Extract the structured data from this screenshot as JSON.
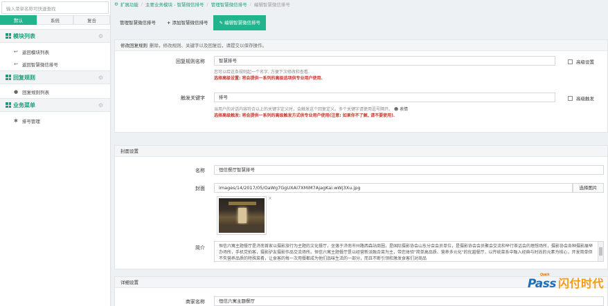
{
  "sidebar": {
    "search_placeholder": "输入菜单名称可快速查找",
    "tabs": [
      "默认",
      "系统",
      "复合"
    ],
    "sections": [
      {
        "title": "模块列表",
        "items": [
          "返回模块列表",
          "返回智慧微信排号"
        ]
      },
      {
        "title": "回复规则",
        "items": [
          "回复规则列表"
        ]
      },
      {
        "title": "业务菜单",
        "items": [
          "排号管理"
        ]
      }
    ]
  },
  "breadcrumb": [
    "扩展功能",
    "主要业务模块 - 智慧微信排号",
    "管理智慧微信排号",
    "编辑智慧微信排号"
  ],
  "tabs": [
    "管理智慧微信排号",
    "添加智慧微信排号",
    "编辑智慧微信排号"
  ],
  "rule_panel": {
    "title": "修改回复规则",
    "note": "删除，修改规则、关键字以及回复后，请提交以保存操作。",
    "rule_name_label": "回复规则名称",
    "rule_name_value": "智慧排号",
    "rule_name_help": "您可以给这条规则起一个名字, 方便下次修改和查看.",
    "rule_name_help_red": "选择高级设置: 将会提供一系列的高级选项供专业用户使用.",
    "advanced_label": "高级设置",
    "keyword_label": "触发关键字",
    "keyword_value": "排号",
    "keyword_help": "当用户的对话内容符合以上的关键字定义时，会触发这个回复定义。多个关键字请使用逗号隔开。",
    "emoji_label": "表情",
    "keyword_help_red": "选择高级触发: 将会提供一系列的高级触发方式供专业用户使用(注意: 如果你不了解, 请不要使用).",
    "advanced_trigger_label": "高级触发"
  },
  "cover_panel": {
    "title": "封面设置",
    "name_label": "名称",
    "name_value": "恒信餐厅智慧排号",
    "cover_label": "封面",
    "cover_value": "images/14/2017/05/OaWg7GgUXAI7XMiM7AjagKai.wWj3Xu.jpg",
    "select_image_label": "选择图片",
    "remove_icon": "×",
    "intro_label": "简介",
    "intro_value": "恒信六寓主题餐厅是济南首家以摄影旅行为主题的文化餐厅，坐落于济南市州路西森站商圈，是国际摄影协会山东分会会员单位，是摄影协会会员聚会交流和举行茶话会的理想场所，摄影协会各种摄影展举办场所，手机党拍客，摄影驴友摄影作品交流场所。恒信六寓主题餐厅是以经营新派融合菜为主，带您体验\"简单高品质、营养多元化\"的优越餐厅，以传统菜系中融入经典与时尚的元素为核心，开发简单但不失营养品质的特殊菜肴，让食客的每一次用餐都成为他们品味生活的一部分，而且不断引领和激发食客们对商品"
  },
  "detail_panel": {
    "title": "详细设置",
    "shop_name_label": "商家名称",
    "shop_name_value": "恒信六寓主题餐厅"
  },
  "watermark": {
    "quick": "Quick",
    "pass": "Pass",
    "cn": "闪付时代"
  },
  "colors": {
    "accent": "#22b58d",
    "link": "#1a9f7a",
    "warn": "#c0392b"
  }
}
